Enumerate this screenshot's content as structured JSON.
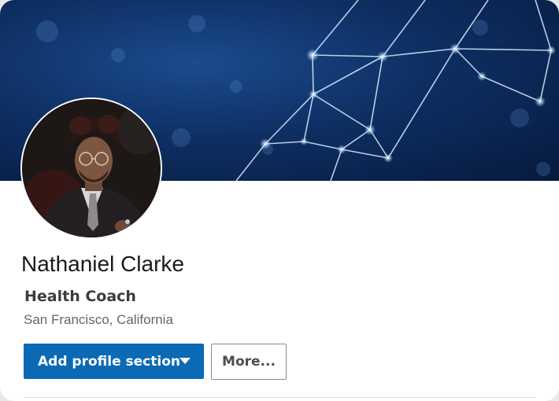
{
  "profile": {
    "name": "Nathaniel Clarke",
    "headline": "Health Coach",
    "location": "San Francisco, California"
  },
  "actions": {
    "add_section_label": "Add profile section",
    "more_label": "More..."
  },
  "icons": {
    "dropdown": "chevron-down-icon"
  },
  "colors": {
    "primary_button": "#0a6ab5",
    "banner": "#0e2f63"
  }
}
